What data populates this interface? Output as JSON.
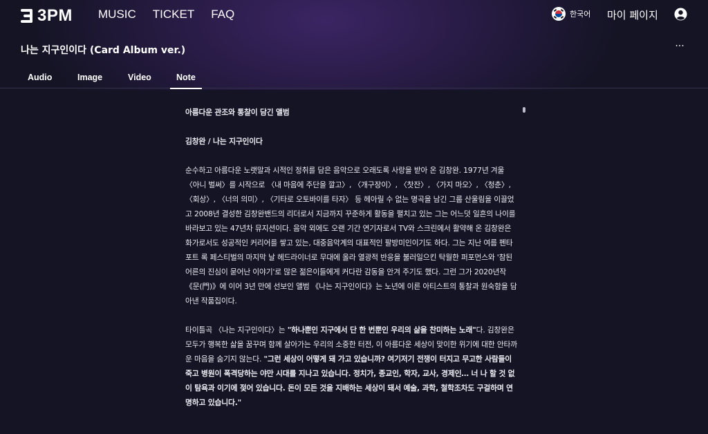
{
  "header": {
    "logo_text": "3PM",
    "nav": [
      {
        "label": "MUSIC"
      },
      {
        "label": "TICKET"
      },
      {
        "label": "FAQ"
      }
    ],
    "language": "한국어",
    "my_page": "마이 페이지",
    "icons": {
      "logo": "3pm-logo-icon",
      "flag": "korea-flag-icon",
      "user": "user-circle-icon",
      "more": "more-dots-icon"
    }
  },
  "album": {
    "title": "나는 지구인이다 (Card Album ver.)",
    "more_label": "···"
  },
  "tabs": [
    {
      "label": "Audio",
      "active": false
    },
    {
      "label": "Image",
      "active": false
    },
    {
      "label": "Video",
      "active": false
    },
    {
      "label": "Note",
      "active": true
    }
  ],
  "note": {
    "headline": "아름다운 관조와 통찰이 담긴 앨범",
    "byline": "김창완 / 나는 지구인이다",
    "para1": "순수하고 아름다운 노랫말과 시적인 정취를 담은 음악으로 오래도록 사랑을 받아 온 김창완. 1977년 겨울 〈아니 벌써〉를 시작으로 〈내 마음에 주단을 깔고〉, 〈개구장이〉, 〈찻잔〉, 〈가지 마오〉, 〈청춘〉, 〈회상〉, 〈너의 의미〉, 〈기타로 오토바이를 타자〉 등 헤아릴 수 없는 명곡을 남긴 그룹 산울림을 이끌었고 2008년 결성한 김창완밴드의 리더로서 지금까지 꾸준하게 활동을 펼치고 있는 그는 어느덧 일흔의 나이를 바라보고 있는 47년차 뮤지션이다. 음악 외에도 오랜 기간 연기자로서 TV와 스크린에서 활약해 온 김창완은 화가로서도 성공적인 커리어를 쌓고 있는, 대중음악계의 대표적인 팔방미인이기도 하다. 그는 지난 여름 펜타포트 록 페스티벌의 마지막 날 헤드라이너로 무대에 올라 열광적 반응을 불러일으킨 탁월한 퍼포먼스와 '참된 어른의 진심이 묻어난 이야기'로 많은 젊은이들에게 커다란 감동을 안겨 주기도 했다. 그런 그가 2020년작 《문(門)》에 이어 3년 만에 선보인 앨범 《나는 지구인이다》는 노년에 이른 아티스트의 통찰과 원숙함을 담아낸 작품집이다.",
    "para2_start": "타이틀곡 〈나는 지구인이다〉는 ",
    "para2_quote": "\"하나뿐인 지구에서 단 한 번뿐인 우리의 삶을 찬미하는 노래\"",
    "para2_mid": "다. 김창완은 모두가 행복한 삶을 꿈꾸며 함께 살아가는 우리의 소중한 터전, 이 아름다운 세상이 맞이한 위기에 대한 안타까운 마음을 숨기지 않는다. ",
    "para2_bold": "\"그런 세상이 어떻게 돼 가고 있습니까? 여기저기 전쟁이 터지고 무고한 사람들이 죽고 병원이 폭격당하는 야만 시대를 지나고 있습니다. 정치가, 종교인, 학자, 교사, 경제인… 너 나 할 것 없이 탐욕과 이기에 젖어 있습니다. 돈이 모든 것을 지배하는 세상이 돼서 예술, 과학, 철학조차도 구걸하며 연명하고 있습니다.\""
  }
}
